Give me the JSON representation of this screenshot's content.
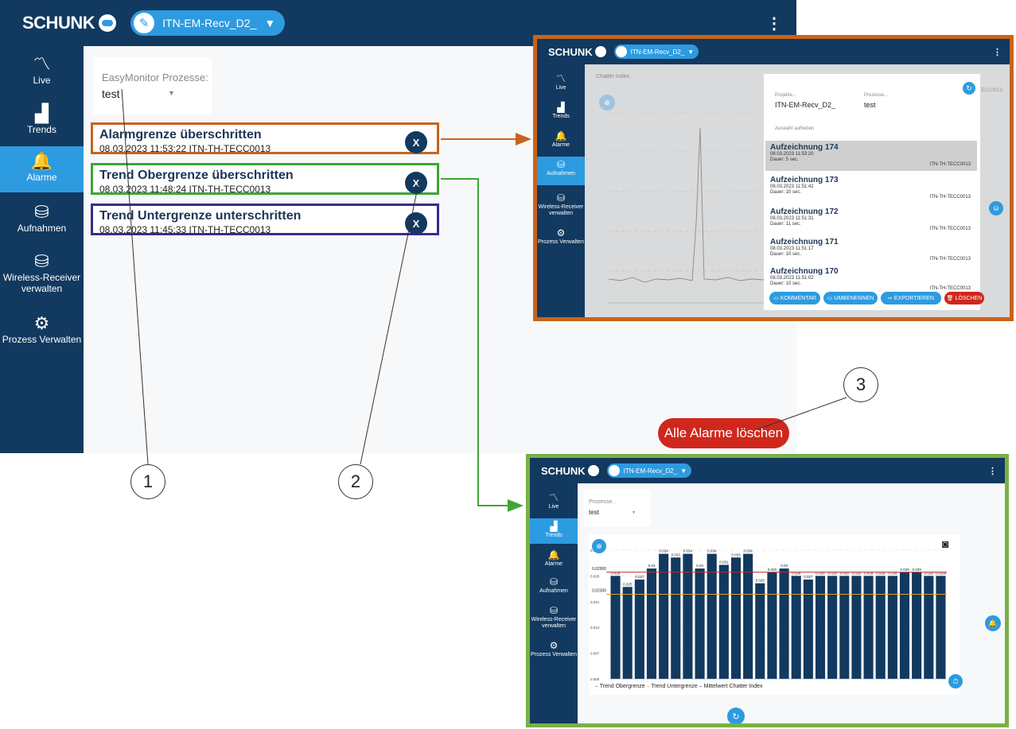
{
  "header": {
    "brand": "SCHUNK",
    "receiver": "ITN-EM-Recv_D2_",
    "menu": "⋮"
  },
  "nav": [
    {
      "label": "Live",
      "icon": "〽"
    },
    {
      "label": "Trends",
      "icon": "▟"
    },
    {
      "label": "Alarme",
      "icon": "🔔"
    },
    {
      "label": "Aufnahmen",
      "icon": "⛁"
    },
    {
      "label": "Wireless-Receiver verwalten",
      "icon": "⛁"
    },
    {
      "label": "Prozess Verwalten",
      "icon": "⚙"
    }
  ],
  "process": {
    "label": "EasyMonitor Prozesse:",
    "value": "test"
  },
  "alarms": [
    {
      "title": "Alarmgrenze überschritten",
      "meta": "08.03.2023 11:53:22 ITN-TH-TECC0013",
      "close": "X"
    },
    {
      "title": "Trend Obergrenze überschritten",
      "meta": "08.03.2023 11:48:24 ITN-TH-TECC0013",
      "close": "X"
    },
    {
      "title": "Trend Untergrenze unterschritten",
      "meta": "08.03.2023 11:45:33 ITN-TH-TECC0013",
      "close": "X"
    }
  ],
  "clear_button": "Alle Alarme löschen",
  "callouts": [
    "1",
    "2",
    "3"
  ],
  "colors": {
    "navy": "#12395f",
    "accent": "#2d9be0",
    "alarm": "#c8631c",
    "upper": "#3fa535",
    "lower": "#3b2b8a",
    "delete": "#d0271d",
    "trends_frame": "#7aaf46"
  },
  "recordings_view": {
    "chart_title": "Chatter Index",
    "projects_label": "Projekte...",
    "project": "ITN-EM-Recv_D2_",
    "process_label": "Prozesse...",
    "process": "test",
    "deselect": "Auswahl aufheben",
    "side_id": "TECC0013",
    "records": [
      {
        "name": "Aufzeichnung 174",
        "date": "08.03.2023 11:53:20",
        "duration": "Dauer: 5 sec.",
        "id": "ITN-TH-TECC0013"
      },
      {
        "name": "Aufzeichnung 173",
        "date": "08.03.2023 11:51:42",
        "duration": "Dauer: 10 sec.",
        "id": "ITN-TH-TECC0013"
      },
      {
        "name": "Aufzeichnung 172",
        "date": "08.03.2023 11:51:31",
        "duration": "Dauer: 11 sec.",
        "id": "ITN-TH-TECC0013"
      },
      {
        "name": "Aufzeichnung 171",
        "date": "08.03.2023 11:51:17",
        "duration": "Dauer: 10 sec.",
        "id": "ITN-TH-TECC0013"
      },
      {
        "name": "Aufzeichnung 170",
        "date": "08.03.2023 11:51:02",
        "duration": "Dauer: 10 sec.",
        "id": "ITN-TH-TECC0013"
      }
    ],
    "actions": [
      "KOMMENTAR",
      "UMBENENNEN",
      "EXPORTIEREN",
      "LÖSCHEN"
    ]
  },
  "trends_view": {
    "process_label": "Prozesse...",
    "process": "test",
    "legend": [
      "Trend Obergrenze",
      "Trend Untergrenze",
      "Mittelwert Chatter Index"
    ]
  },
  "chart_data": {
    "type": "bar",
    "values": [
      0.028,
      0.025,
      0.027,
      0.03,
      0.034,
      0.033,
      0.034,
      0.03,
      0.034,
      0.031,
      0.033,
      0.034,
      0.026,
      0.029,
      0.03,
      0.028,
      0.027,
      0.028,
      0.028,
      0.028,
      0.028,
      0.028,
      0.028,
      0.028,
      0.029,
      0.029,
      0.028,
      0.028
    ],
    "value_labels": [
      "0.028",
      "0.025",
      "0.027",
      "0.03",
      "0.034",
      "0.033",
      "0.034",
      "0.03",
      "0.034",
      "0.031",
      "0.033",
      "0.034",
      "0.026",
      "0.029",
      "0.03",
      "0.028",
      "0.027",
      "0.028",
      "0.028",
      "0.028",
      "0.028",
      "0.028",
      "0.028",
      "0.028",
      "0.029",
      "0.029",
      "0.028",
      "0.0290"
    ],
    "upper_limit": 0.029,
    "lower_limit": 0.023,
    "upper_label": "0,02900",
    "lower_label": "0,02300",
    "yticks": [
      "0.000",
      "0.007",
      "0.014",
      "0.021",
      "0.028",
      "0.035"
    ],
    "ylim": [
      0,
      0.035
    ]
  }
}
